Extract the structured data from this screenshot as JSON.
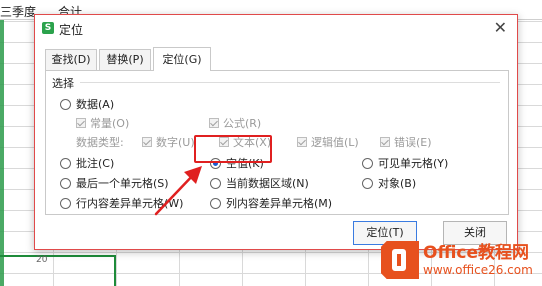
{
  "sheet": {
    "col_headers": [
      "三季度",
      "合计"
    ],
    "row_number": "20"
  },
  "dialog": {
    "title": "定位",
    "tabs": [
      {
        "label": "查找(D)"
      },
      {
        "label": "替换(P)"
      },
      {
        "label": "定位(G)",
        "active": true
      }
    ],
    "group_label": "选择",
    "options": {
      "data": "数据(A)",
      "constant": "常量(O)",
      "formula": "公式(R)",
      "data_type_label": "数据类型:",
      "number": "数字(U)",
      "text": "文本(X)",
      "logical": "逻辑值(L)",
      "error": "错误(E)",
      "comment": "批注(C)",
      "blank": "空值(K)",
      "visible": "可见单元格(Y)",
      "last_cell": "最后一个单元格(S)",
      "current_region": "当前数据区域(N)",
      "object": "对象(B)",
      "row_diff": "行内容差异单元格(W)",
      "col_diff": "列内容差异单元格(M)"
    },
    "selected_option": "blank",
    "buttons": {
      "locate": "定位(T)",
      "close": "关闭"
    }
  },
  "watermark": {
    "line1": "Office教程网",
    "line2": "www.office26.com"
  },
  "colors": {
    "accent": "#e02020",
    "brand": "#e7511e",
    "selection": "#1a5bd0",
    "sheet_green": "#1e8b3a"
  }
}
